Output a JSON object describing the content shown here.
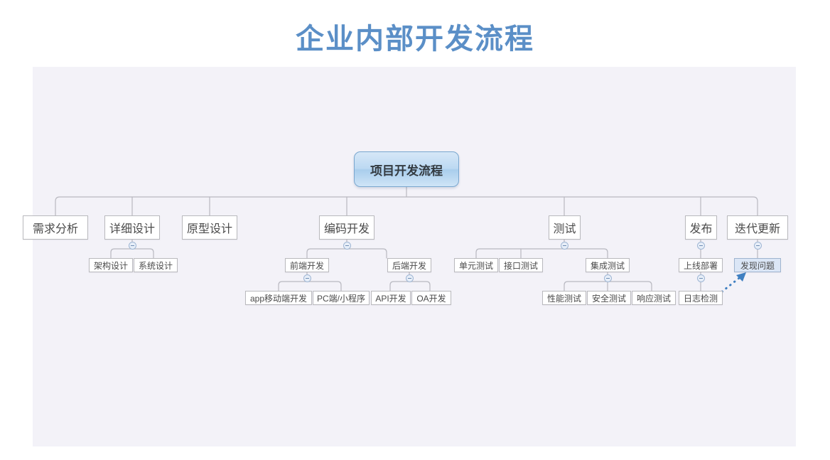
{
  "page": {
    "title": "企业内部开发流程",
    "title_color": "#5b8fc7",
    "canvas_color": "#f3f2f8",
    "background_color": "#ffffff"
  },
  "diagram": {
    "type": "mindmap",
    "root": {
      "label": "项目开发流程"
    },
    "level2": [
      {
        "label": "需求分析"
      },
      {
        "label": "详细设计"
      },
      {
        "label": "原型设计"
      },
      {
        "label": "编码开发"
      },
      {
        "label": "测试"
      },
      {
        "label": "发布"
      },
      {
        "label": "迭代更新"
      }
    ],
    "level3": [
      {
        "label": "架构设计",
        "parent": "详细设计"
      },
      {
        "label": "系统设计",
        "parent": "详细设计"
      },
      {
        "label": "前端开发",
        "parent": "编码开发"
      },
      {
        "label": "后端开发",
        "parent": "编码开发"
      },
      {
        "label": "单元测试",
        "parent": "测试"
      },
      {
        "label": "接口测试",
        "parent": "测试"
      },
      {
        "label": "集成测试",
        "parent": "测试"
      },
      {
        "label": "上线部署",
        "parent": "发布"
      },
      {
        "label": "发现问题",
        "parent": "迭代更新",
        "highlight": true
      }
    ],
    "level4": [
      {
        "label": "app移动端开发",
        "parent": "前端开发"
      },
      {
        "label": "PC端/小程序",
        "parent": "前端开发"
      },
      {
        "label": "API开发",
        "parent": "后端开发"
      },
      {
        "label": "OA开发",
        "parent": "后端开发"
      },
      {
        "label": "性能测试",
        "parent": "集成测试"
      },
      {
        "label": "安全测试",
        "parent": "集成测试"
      },
      {
        "label": "响应测试",
        "parent": "集成测试"
      },
      {
        "label": "日志检测",
        "parent": "上线部署"
      }
    ],
    "feedback_arrow": {
      "from": "日志检测",
      "to": "发现问题",
      "style": "dotted",
      "color": "#3f7fc1"
    },
    "connector_color": "#b8b8c0"
  }
}
